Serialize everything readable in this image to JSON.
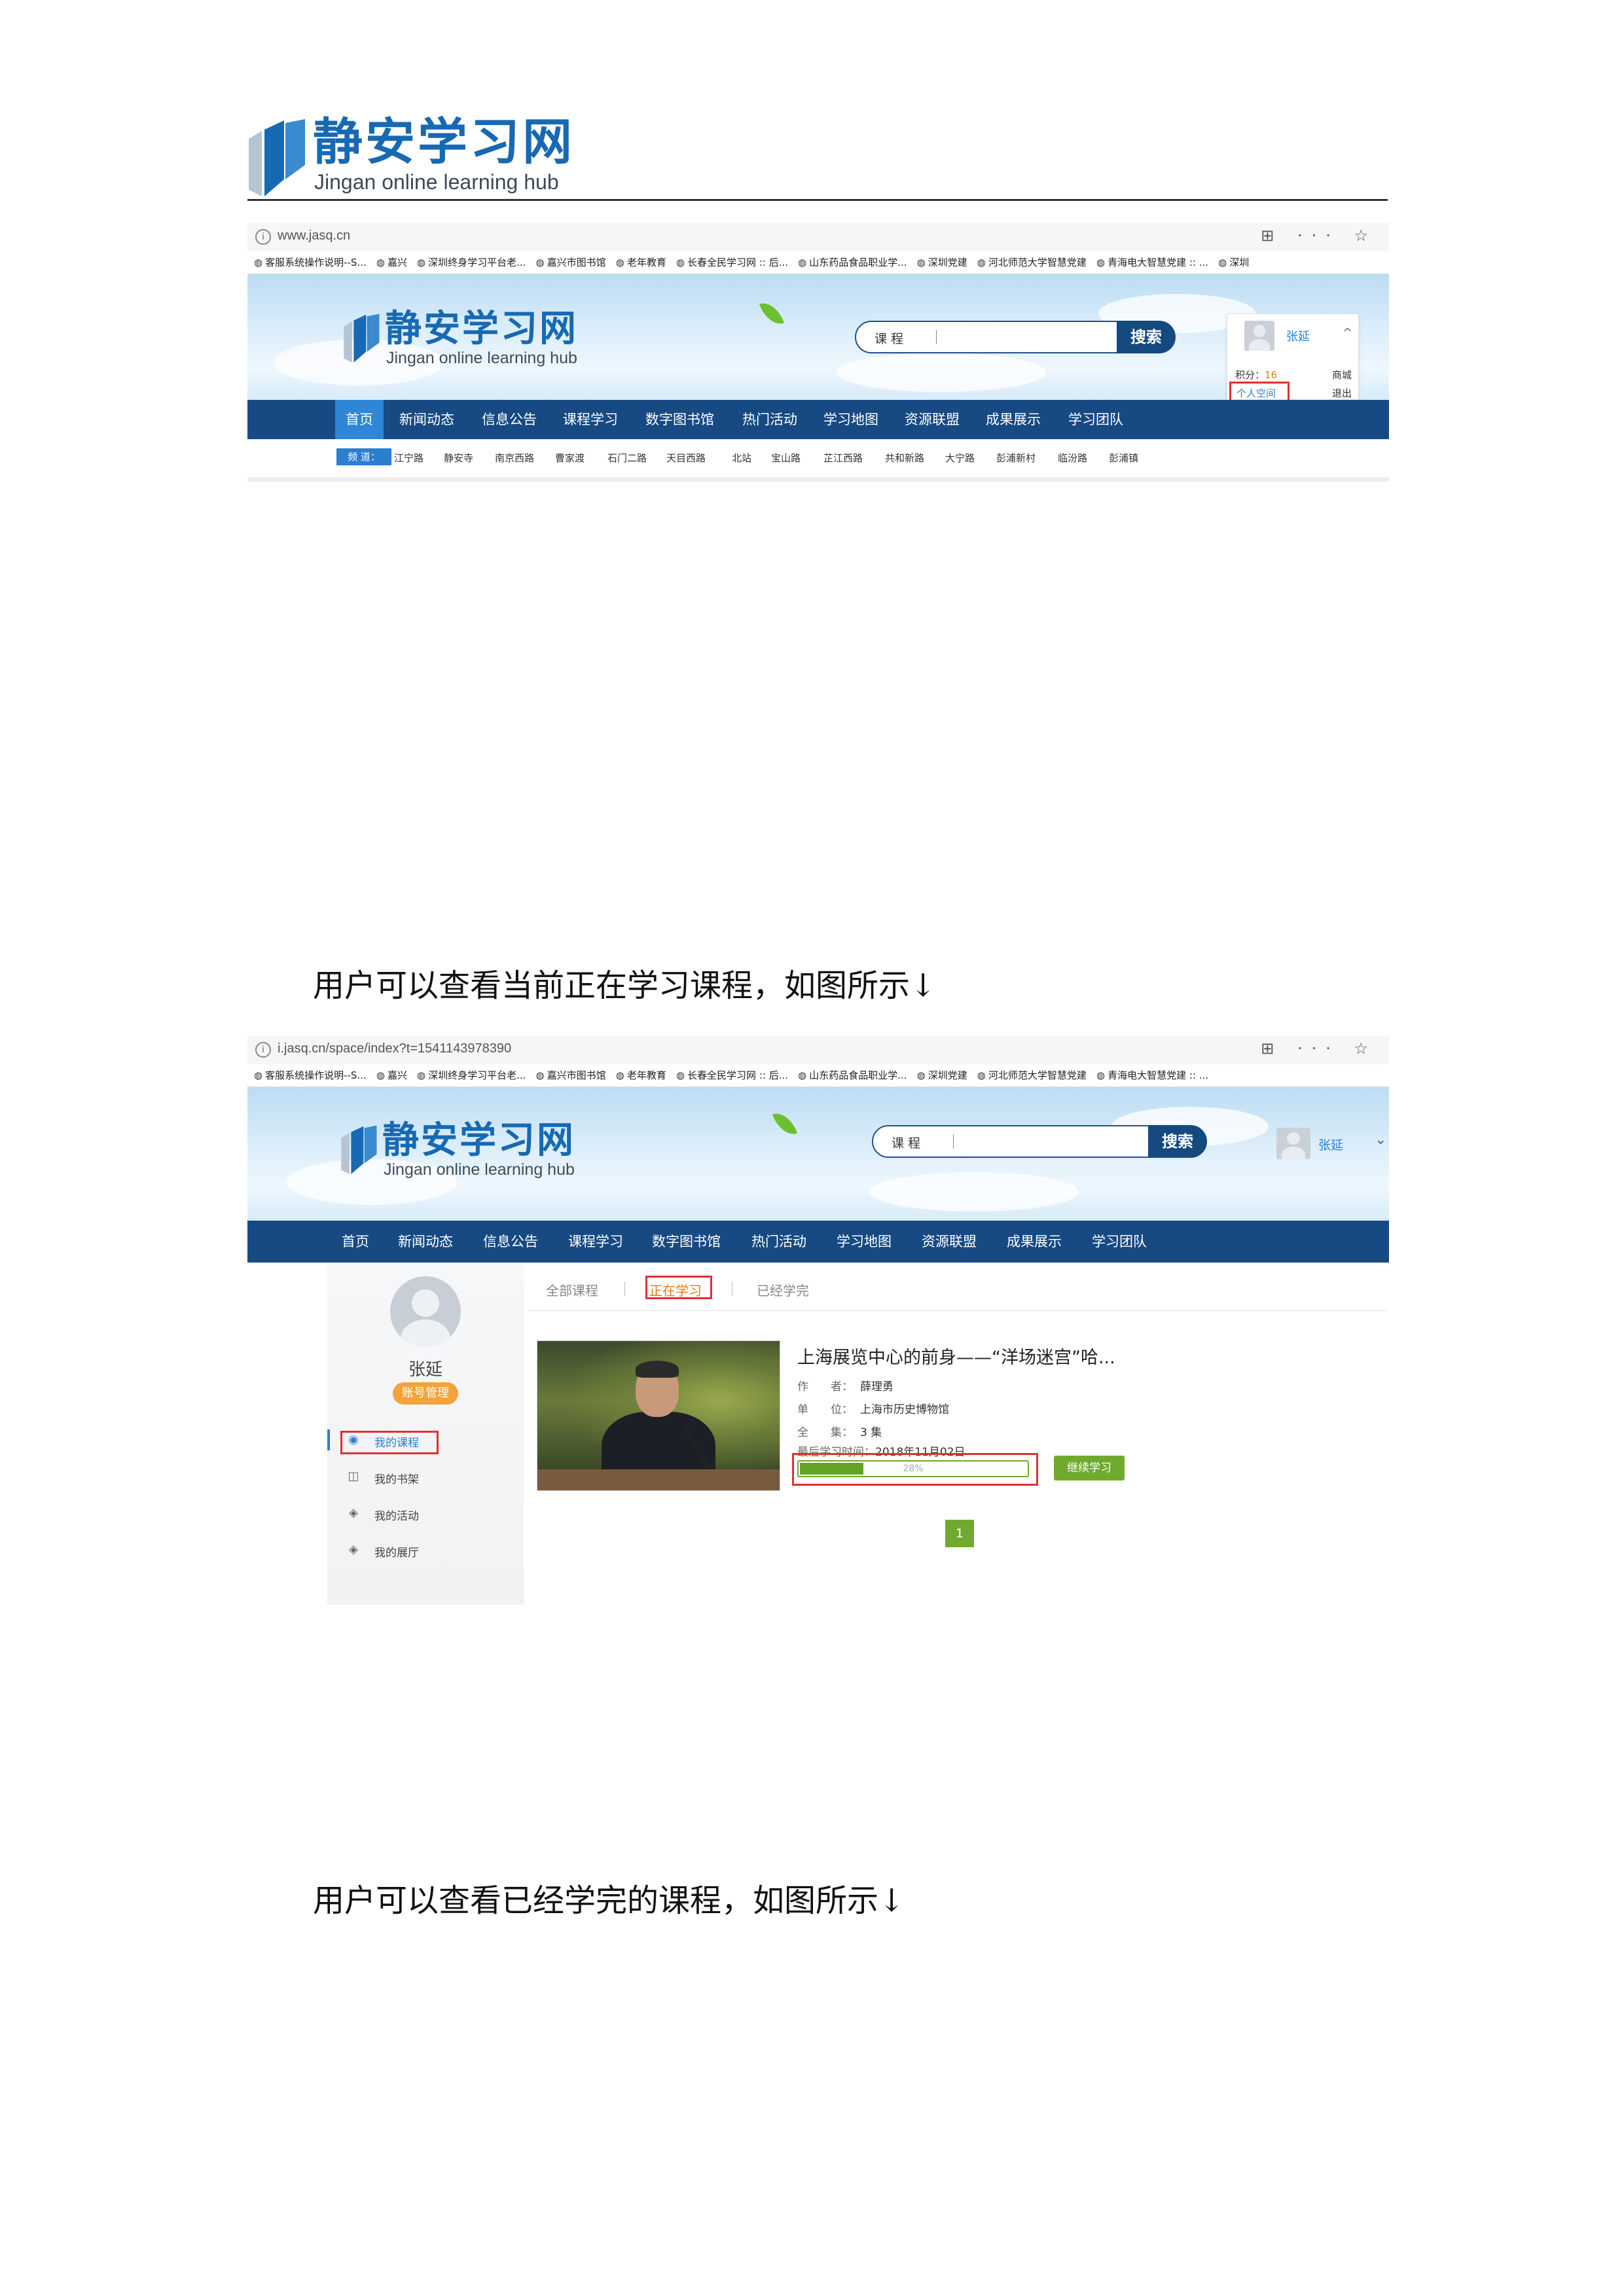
{
  "doc_header": {
    "logo_title": "静安学习网",
    "logo_subtitle": "Jingan online learning hub"
  },
  "shot1": {
    "url": "www.jasq.cn",
    "tools": "⊞ ··· ☆",
    "bookmarks": [
      "客服系统操作说明--S...",
      "嘉兴",
      "深圳终身学习平台老...",
      "嘉兴市图书馆",
      "老年教育",
      "长春全民学习网 :: 后...",
      "山东药品食品职业学...",
      "深圳党建",
      "河北师范大学智慧党建",
      "青海电大智慧党建 :: ...",
      "深圳"
    ],
    "site_title": "静安学习网",
    "site_subtitle": "Jingan online learning hub",
    "search_label": "课 程",
    "search_button": "搜索",
    "user_name": "张延",
    "points_label": "积分：",
    "points_value": "16",
    "mall": "商城",
    "personal_space": "个人空间",
    "logout": "退出",
    "chevron": "^",
    "nav": [
      "首页",
      "新闻动态",
      "信息公告",
      "课程学习",
      "数字图书馆",
      "热门活动",
      "学习地图",
      "资源联盟",
      "成果展示",
      "学习团队"
    ],
    "subnav_tag": "频  道：",
    "subnav": [
      "江宁路",
      "静安寺",
      "南京西路",
      "曹家渡",
      "石门二路",
      "天目西路",
      "北站",
      "宝山路",
      "芷江西路",
      "共和新路",
      "大宁路",
      "彭浦新村",
      "临汾路",
      "彭浦镇"
    ]
  },
  "caption1": "用户可以查看当前正在学习课程，如图所示↓",
  "shot2": {
    "url": "i.jasq.cn/space/index?t=1541143978390",
    "tools": "⊞ ··· ☆",
    "bookmarks": [
      "客服系统操作说明--S...",
      "嘉兴",
      "深圳终身学习平台老...",
      "嘉兴市图书馆",
      "老年教育",
      "长春全民学习网 :: 后...",
      "山东药品食品职业学...",
      "深圳党建",
      "河北师范大学智慧党建",
      "青海电大智慧党建 :: ..."
    ],
    "site_title": "静安学习网",
    "site_subtitle": "Jingan online learning hub",
    "search_label": "课 程",
    "search_button": "搜索",
    "user_name": "张延",
    "chevron": "⌄",
    "nav": [
      "首页",
      "新闻动态",
      "信息公告",
      "课程学习",
      "数字图书馆",
      "热门活动",
      "学习地图",
      "资源联盟",
      "成果展示",
      "学习团队"
    ],
    "profile_name": "张延",
    "account_button": "账号管理",
    "side_menu": [
      {
        "label": "我的课程",
        "icon": "◉"
      },
      {
        "label": "我的书架",
        "icon": "◫"
      },
      {
        "label": "我的活动",
        "icon": "◈"
      },
      {
        "label": "我的展厅",
        "icon": "◈"
      }
    ],
    "tabs": [
      "全部课程",
      "正在学习",
      "已经学完"
    ],
    "course": {
      "title": "上海展览中心的前身——“洋场迷宫”哈...",
      "author_label": "作　　者：",
      "author": "薛理勇",
      "unit_label": "单　　位：",
      "unit": "上海市历史博物馆",
      "episodes_label": "全　　集：",
      "episodes": "3 集",
      "last_label": "最后学习时间：",
      "last_time": "2018年11月02日",
      "progress_text": "28%",
      "progress_value": 0.28,
      "continue": "继续学习"
    },
    "page_number": "1"
  },
  "caption2": "用户可以查看已经学完的课程，如图所示↓",
  "colors": {
    "brand_blue": "#1769b3",
    "nav_blue": "#174a83",
    "highlight_red": "#e03131",
    "green": "#6faa2e",
    "orange": "#f2a33a"
  }
}
